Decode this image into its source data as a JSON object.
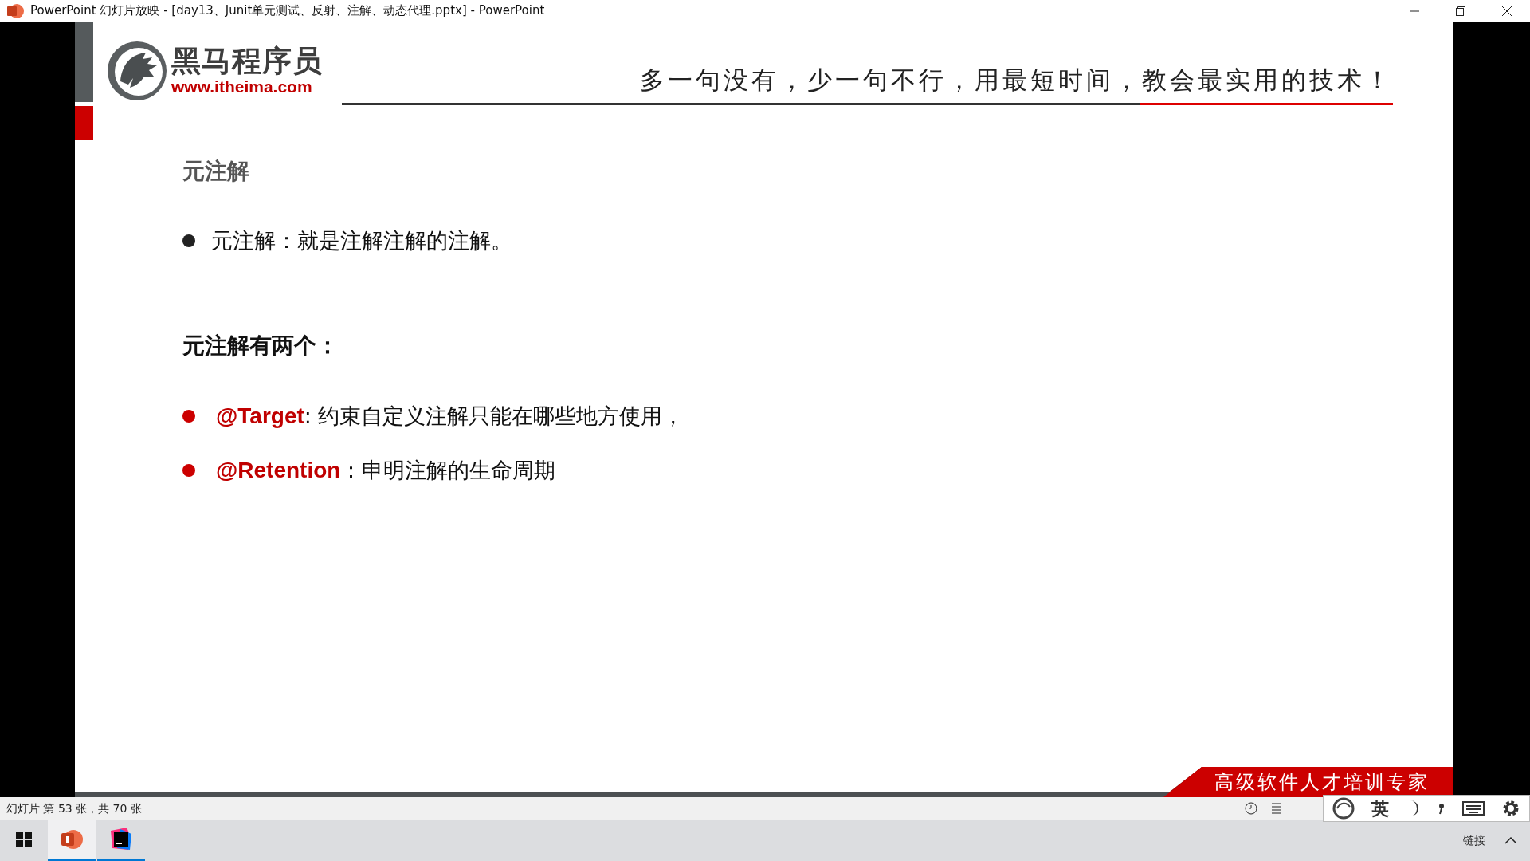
{
  "window": {
    "title": "PowerPoint 幻灯片放映 - [day13、Junit单元测试、反射、注解、动态代理.pptx] - PowerPoint"
  },
  "slide": {
    "logo": {
      "name": "黑马程序员",
      "url": "www.itheima.com"
    },
    "slogan": "多一句没有，少一句不行，用最短时间，教会最实用的技术！",
    "sections": [
      {
        "heading": "元注解",
        "kind": "subtitle",
        "bullets": [
          {
            "kind": "plain",
            "text": "元注解：就是注解注解的注解。"
          }
        ]
      },
      {
        "heading": "元注解有两个：",
        "kind": "list-title",
        "bullets": [
          {
            "kind": "keyword",
            "term": "@Target",
            "text": ": 约束自定义注解只能在哪些地方使用，"
          },
          {
            "kind": "keyword",
            "term": "@Retention",
            "text": "：申明注解的生命周期"
          }
        ]
      }
    ],
    "banner": "高级软件人才培训专家"
  },
  "status_bar": {
    "slide_counter": "幻灯片 第 53 张，共 70 张"
  },
  "ime_toolbar": {
    "mode": "英"
  },
  "taskbar": {
    "apps": [
      {
        "kind": "presentation",
        "selected": true
      },
      {
        "kind": "ide",
        "selected": false
      }
    ],
    "tray_label": "链接"
  }
}
